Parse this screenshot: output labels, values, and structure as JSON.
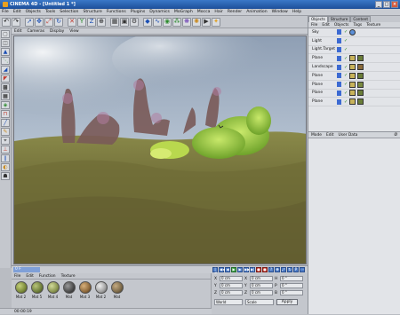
{
  "window": {
    "app": "CINEMA 4D",
    "doc": "[Untitled 1 *]"
  },
  "menu": [
    "File",
    "Edit",
    "Objects",
    "Tools",
    "Selection",
    "Structure",
    "Functions",
    "Plugins",
    "Dynamics",
    "MoGraph",
    "Mocca",
    "Hair",
    "Render",
    "Animation",
    "Window",
    "Help"
  ],
  "viewport": {
    "menu": [
      "Edit",
      "Cameras",
      "Display",
      "View"
    ]
  },
  "timeline": {
    "frame": "0 F"
  },
  "materials": {
    "menu": [
      "File",
      "Edit",
      "Function",
      "Texture"
    ],
    "items": [
      {
        "label": "Mat 2",
        "color": "#7b8a3a"
      },
      {
        "label": "Mat 5",
        "color": "#6f7f3b"
      },
      {
        "label": "Mat 4",
        "color": "#8a9550"
      },
      {
        "label": "Mat",
        "color": "#4c4c4c"
      },
      {
        "label": "Mat 3",
        "color": "#8f6a3c"
      },
      {
        "label": "Mat 2",
        "color": "#a2a2a2"
      },
      {
        "label": "Mat",
        "color": "#7e6b4a"
      }
    ]
  },
  "status": {
    "time": "00:00:19"
  },
  "coordinates": {
    "rows": [
      {
        "a": "X",
        "av": "0 cm",
        "b": "X",
        "bv": "0 cm",
        "c": "H",
        "cv": "0 °"
      },
      {
        "a": "Y",
        "av": "0 cm",
        "b": "Y",
        "bv": "0 cm",
        "c": "P",
        "cv": "0 °"
      },
      {
        "a": "Z",
        "av": "0 cm",
        "b": "Z",
        "bv": "0 cm",
        "c": "B",
        "cv": "0 °"
      }
    ],
    "mode": "World",
    "size_mode": "Scale",
    "apply": "Apply"
  },
  "objects": {
    "tabs": [
      "Objects",
      "Structure",
      "Content"
    ],
    "menu": [
      "File",
      "Edit",
      "Objects",
      "Tags",
      "Texture"
    ],
    "items": [
      {
        "name": "Sky",
        "tag": "#5b8fd8"
      },
      {
        "name": "Light",
        "tag": ""
      },
      {
        "name": "Light.Target",
        "tag": ""
      },
      {
        "name": "Plane",
        "tag": "#6a7d38"
      },
      {
        "name": "Landscape",
        "tag": "#8a6a3a"
      },
      {
        "name": "Plane",
        "tag": "#6a7d38"
      },
      {
        "name": "Plane",
        "tag": "#7a8a40"
      },
      {
        "name": "Plane",
        "tag": "#6a7d38"
      },
      {
        "name": "Plane",
        "tag": "#6a7d38"
      }
    ]
  },
  "attributes": {
    "menu": [
      "Mode",
      "Edit",
      "User Data"
    ],
    "extra": "Ø"
  },
  "icons": [
    "undo-icon",
    "redo-icon",
    "cursor-icon",
    "move-icon",
    "scale-icon",
    "rotate-icon",
    "render-icon",
    "cube-icon",
    "camera-icon",
    "light-icon"
  ]
}
